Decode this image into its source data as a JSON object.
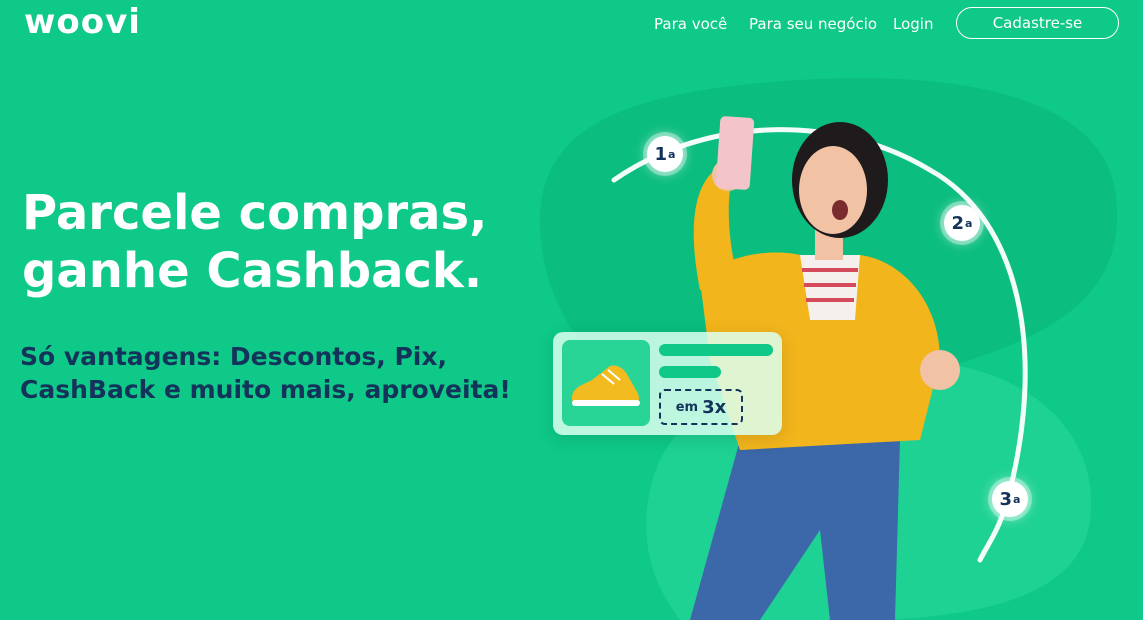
{
  "header": {
    "logo": "woovi",
    "nav": [
      "Para você",
      "Para seu negócio",
      "Login"
    ],
    "cta": "Cadastre-se"
  },
  "hero": {
    "headline": "Parcele compras, ganhe Cashback.",
    "subheadline": "Só vantagens: Descontos, Pix, CashBack e muito mais, aproveita!"
  },
  "illustration": {
    "installment_prefix": "em",
    "installment_value": "3x",
    "badges": [
      {
        "num": "1",
        "ord": "a"
      },
      {
        "num": "2",
        "ord": "a"
      },
      {
        "num": "3",
        "ord": "a"
      }
    ]
  },
  "colors": {
    "background": "#0ec987",
    "dark_text": "#14335b"
  }
}
